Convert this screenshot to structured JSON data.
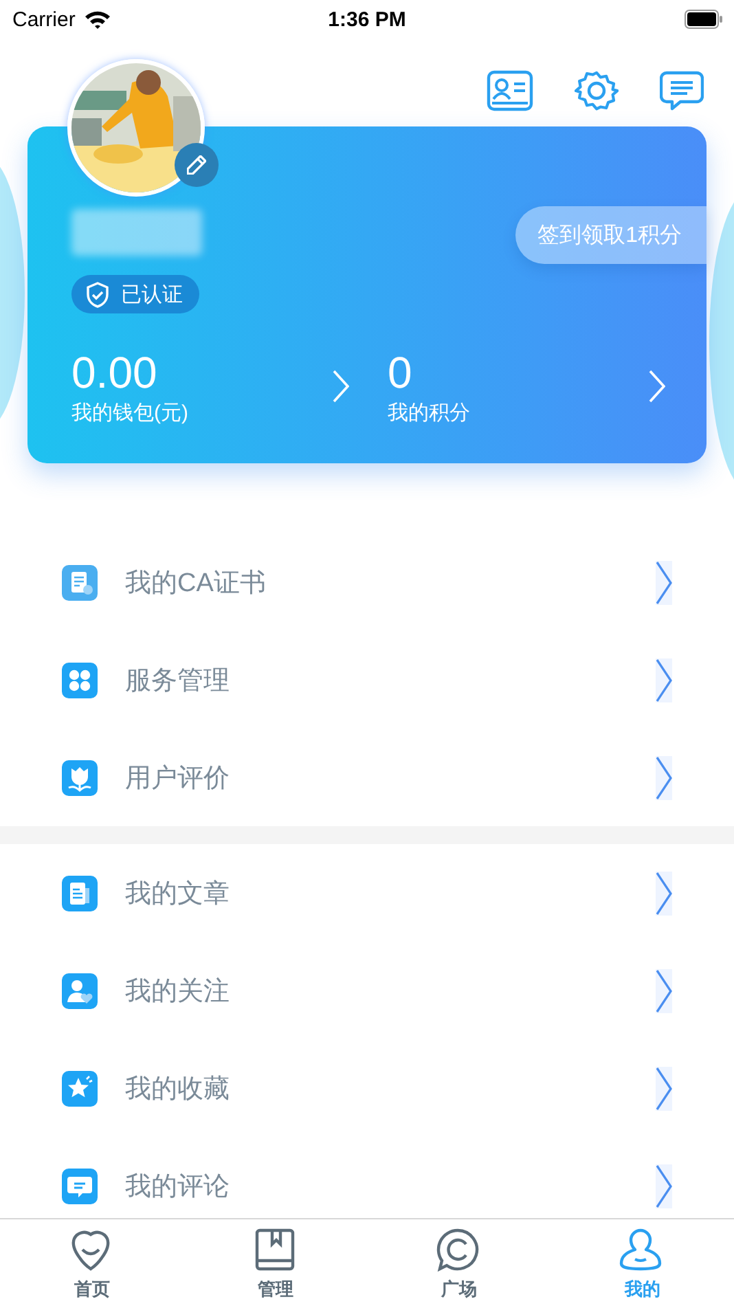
{
  "status_bar": {
    "carrier": "Carrier",
    "time": "1:36 PM"
  },
  "profile": {
    "verified": "已认证",
    "checkin": "签到领取1积分",
    "stats": [
      {
        "value": "0.00",
        "label": "我的钱包(元)"
      },
      {
        "value": "0",
        "label": "我的积分"
      }
    ]
  },
  "menu_sections": [
    {
      "items": [
        {
          "label": "我的CA证书"
        },
        {
          "label": "服务管理"
        },
        {
          "label": "用户评价"
        }
      ]
    },
    {
      "items": [
        {
          "label": "我的文章"
        },
        {
          "label": "我的关注"
        },
        {
          "label": "我的收藏"
        },
        {
          "label": "我的评论"
        }
      ]
    }
  ],
  "tabs": [
    {
      "label": "首页",
      "selected": false
    },
    {
      "label": "管理",
      "selected": false
    },
    {
      "label": "广场",
      "selected": false
    },
    {
      "label": "我的",
      "selected": true
    }
  ]
}
